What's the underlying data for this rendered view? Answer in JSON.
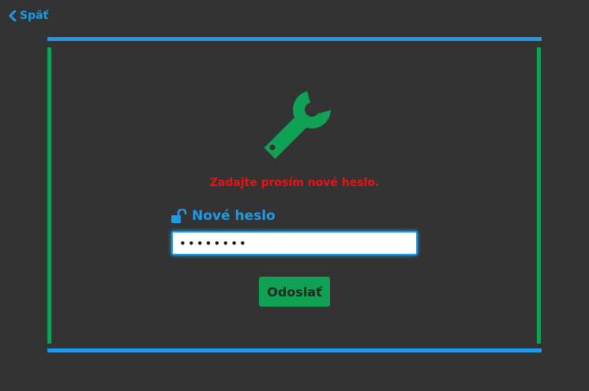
{
  "nav": {
    "back_label": "Späť",
    "back_icon": "chevron-left-icon"
  },
  "hero": {
    "icon": "wrench-icon",
    "icon_color": "#10a154"
  },
  "form": {
    "message": "Zadajte prosím nové heslo.",
    "password_label": "Nové heslo",
    "password_label_icon": "unlock-icon",
    "password_value": "••••••••",
    "submit_label": "Odoslať"
  },
  "colors": {
    "background": "#333333",
    "accent_blue": "#1e9be8",
    "accent_green": "#10a154",
    "error_red": "#ee1111"
  }
}
